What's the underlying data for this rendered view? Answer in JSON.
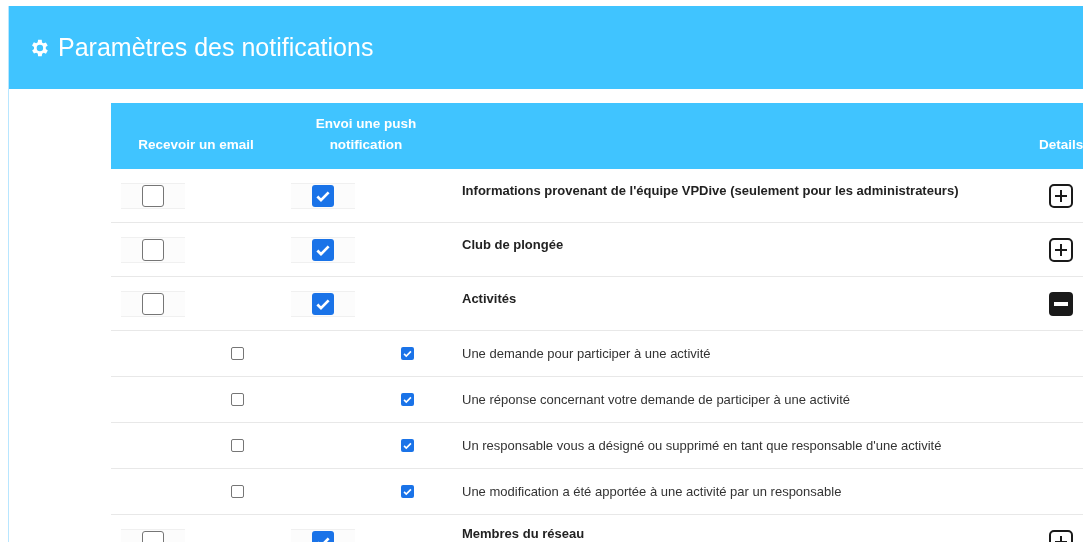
{
  "header": {
    "title": "Paramètres des notifications"
  },
  "columns": [
    "Recevoir un email",
    "Envoi une push notification",
    "Details"
  ],
  "categories": [
    {
      "label": "Informations provenant de l'équipe VPDive (seulement pour les administrateurs)",
      "email": false,
      "push": true,
      "expanded": false
    },
    {
      "label": "Club de plongée",
      "email": false,
      "push": true,
      "expanded": false
    },
    {
      "label": "Activités",
      "email": false,
      "push": true,
      "expanded": true,
      "children": [
        {
          "label": "Une demande pour participer à une activité",
          "email": false,
          "push": true
        },
        {
          "label": "Une réponse concernant votre demande de participer à une activité",
          "email": false,
          "push": true
        },
        {
          "label": "Un responsable vous a désigné ou supprimé en tant que responsable d'une activité",
          "email": false,
          "push": true
        },
        {
          "label": "Une modification a été apportée à une activité par un responsable",
          "email": false,
          "push": true
        }
      ]
    },
    {
      "label": "Membres du réseau",
      "email": false,
      "push": true,
      "expanded": false
    }
  ]
}
